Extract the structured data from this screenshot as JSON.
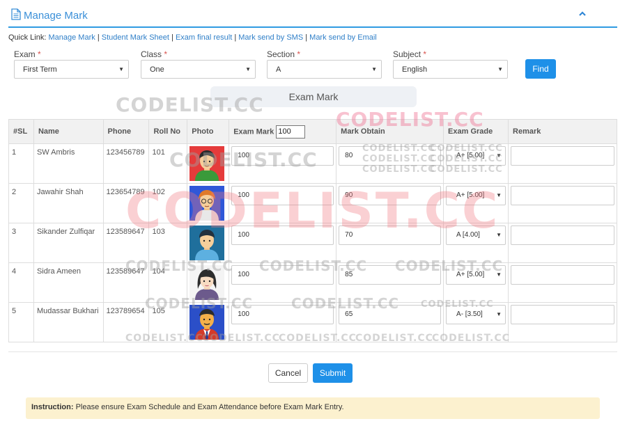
{
  "header": {
    "title": "Manage Mark"
  },
  "quick_links": {
    "prefix": "Quick Link:",
    "links": [
      "Manage Mark",
      "Student Mark Sheet",
      "Exam final result",
      "Mark send by SMS",
      "Mark send by Email"
    ]
  },
  "filters": {
    "exam": {
      "label": "Exam",
      "value": "First Term"
    },
    "class": {
      "label": "Class",
      "value": "One"
    },
    "section": {
      "label": "Section",
      "value": "A"
    },
    "subject": {
      "label": "Subject",
      "value": "English"
    },
    "required_mark": "*",
    "find_label": "Find"
  },
  "section_title": "Exam Mark",
  "table": {
    "headers": {
      "sl": "#SL",
      "name": "Name",
      "phone": "Phone",
      "roll": "Roll No",
      "photo": "Photo",
      "exam_mark": "Exam Mark",
      "mark_obtain": "Mark Obtain",
      "grade": "Exam Grade",
      "remark": "Remark"
    },
    "exam_mark_default": "100",
    "rows": [
      {
        "sl": "1",
        "name": "SW Ambris",
        "phone": "123456789",
        "roll": "101",
        "exam_mark": "100",
        "obtain": "80",
        "grade": "A+ [5.00]",
        "remark": ""
      },
      {
        "sl": "2",
        "name": "Jawahir Shah",
        "phone": "123654789",
        "roll": "102",
        "exam_mark": "100",
        "obtain": "90",
        "grade": "A+ [5.00]",
        "remark": ""
      },
      {
        "sl": "3",
        "name": "Sikander Zulfiqar",
        "phone": "123589647",
        "roll": "103",
        "exam_mark": "100",
        "obtain": "70",
        "grade": "A [4.00]",
        "remark": ""
      },
      {
        "sl": "4",
        "name": "Sidra Ameen",
        "phone": "123589647",
        "roll": "104",
        "exam_mark": "100",
        "obtain": "85",
        "grade": "A+ [5.00]",
        "remark": ""
      },
      {
        "sl": "5",
        "name": "Mudassar Bukhari",
        "phone": "123789654",
        "roll": "105",
        "exam_mark": "100",
        "obtain": "65",
        "grade": "A- [3.50]",
        "remark": ""
      }
    ]
  },
  "buttons": {
    "cancel": "Cancel",
    "submit": "Submit"
  },
  "instruction": {
    "label": "Instruction:",
    "text": "Please ensure Exam Schedule and Exam Attendance before Exam Mark Entry."
  },
  "watermark": {
    "text": "CODELIST.CC"
  },
  "colors": {
    "accent": "#1e90e8",
    "link": "#2f7fc8",
    "instruction_bg": "#fcf1cf"
  },
  "icons": {
    "header": "document-icon",
    "collapse": "chevron-up-icon",
    "select": "caret-down-icon"
  }
}
